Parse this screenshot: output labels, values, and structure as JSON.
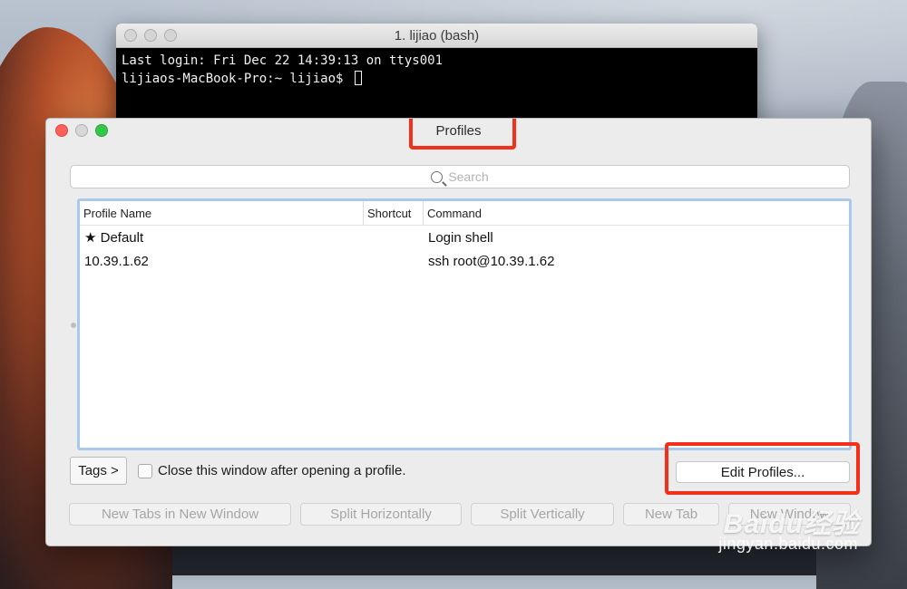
{
  "terminal": {
    "title": "1. lijiao (bash)",
    "lines": [
      "Last login: Fri Dec 22 14:39:13 on ttys001",
      "lijiaos-MacBook-Pro:~ lijiao$ "
    ]
  },
  "profiles_window": {
    "title": "Profiles",
    "search": {
      "placeholder": "Search"
    },
    "table": {
      "columns": [
        "Profile Name",
        "Shortcut",
        "Command"
      ],
      "rows": [
        {
          "name": "★ Default",
          "shortcut": "",
          "command": "Login shell"
        },
        {
          "name": "10.39.1.62",
          "shortcut": "",
          "command": "ssh root@10.39.1.62"
        }
      ]
    },
    "tags_label": "Tags >",
    "close_option_label": "Close this window after opening a profile.",
    "edit_profiles_label": "Edit Profiles...",
    "buttons": [
      {
        "label": "New Tabs in New Window"
      },
      {
        "label": "Split Horizontally"
      },
      {
        "label": "Split Vertically"
      },
      {
        "label": "New Tab"
      },
      {
        "label": "New Window"
      }
    ]
  },
  "watermark": {
    "brand": "Baidu经验",
    "url": "jingyan.baidu.com"
  },
  "colors": {
    "highlight": "#f5301a",
    "table_focus": "#a8c8ec"
  }
}
